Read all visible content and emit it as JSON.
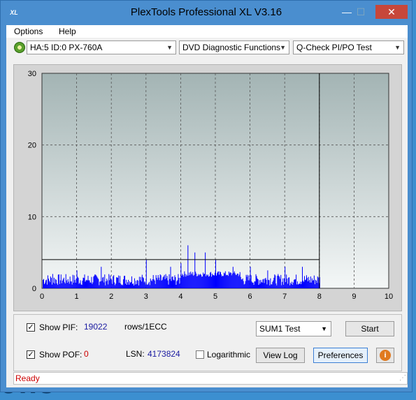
{
  "window": {
    "title": "PlexTools Professional XL V3.16",
    "app_icon_text": "XL",
    "min_glyph": "—",
    "max_glyph": "☐",
    "close_glyph": "✕"
  },
  "menu": {
    "options": "Options",
    "help": "Help"
  },
  "toolbar": {
    "drive": "HA:5 ID:0  PX-760A",
    "function": "DVD Diagnostic Functions",
    "test": "Q-Check PI/PO Test",
    "arrow_glyph": "▼"
  },
  "chart_data": {
    "type": "bar",
    "x_range": [
      0,
      10
    ],
    "y_range": [
      0,
      30
    ],
    "x_ticks": [
      "0",
      "1",
      "2",
      "3",
      "4",
      "5",
      "6",
      "7",
      "8",
      "9",
      "10"
    ],
    "y_ticks": [
      "0",
      "10",
      "20",
      "30"
    ],
    "threshold": 4,
    "end_marker_x": 8,
    "data_end_x": 8,
    "series_color": "#0000ff",
    "grid": true,
    "peaks": [
      {
        "x": 0.3,
        "y": 2
      },
      {
        "x": 1.0,
        "y": 2.5
      },
      {
        "x": 1.7,
        "y": 3
      },
      {
        "x": 3.0,
        "y": 4
      },
      {
        "x": 3.7,
        "y": 3
      },
      {
        "x": 4.0,
        "y": 3.5
      },
      {
        "x": 4.2,
        "y": 6
      },
      {
        "x": 4.4,
        "y": 5
      },
      {
        "x": 4.7,
        "y": 5
      },
      {
        "x": 5.0,
        "y": 4
      },
      {
        "x": 5.5,
        "y": 3
      },
      {
        "x": 6.0,
        "y": 3
      },
      {
        "x": 6.5,
        "y": 2.5
      },
      {
        "x": 7.0,
        "y": 3
      },
      {
        "x": 7.5,
        "y": 3
      }
    ]
  },
  "controls": {
    "show_pif_label": "Show PIF:",
    "pif_value": "19022",
    "rows_label": "rows/1ECC",
    "show_pof_label": "Show POF:",
    "pof_value": "0",
    "lsn_label": "LSN:",
    "lsn_value": "4173824",
    "log_label": "Logarithmic",
    "sum_select": "SUM1 Test",
    "start_button": "Start",
    "viewlog_button": "View Log",
    "prefs_button": "Preferences",
    "check_glyph": "✓",
    "info_glyph": "i"
  },
  "status": {
    "text": "Ready"
  },
  "desktop": {
    "text": "ows"
  }
}
